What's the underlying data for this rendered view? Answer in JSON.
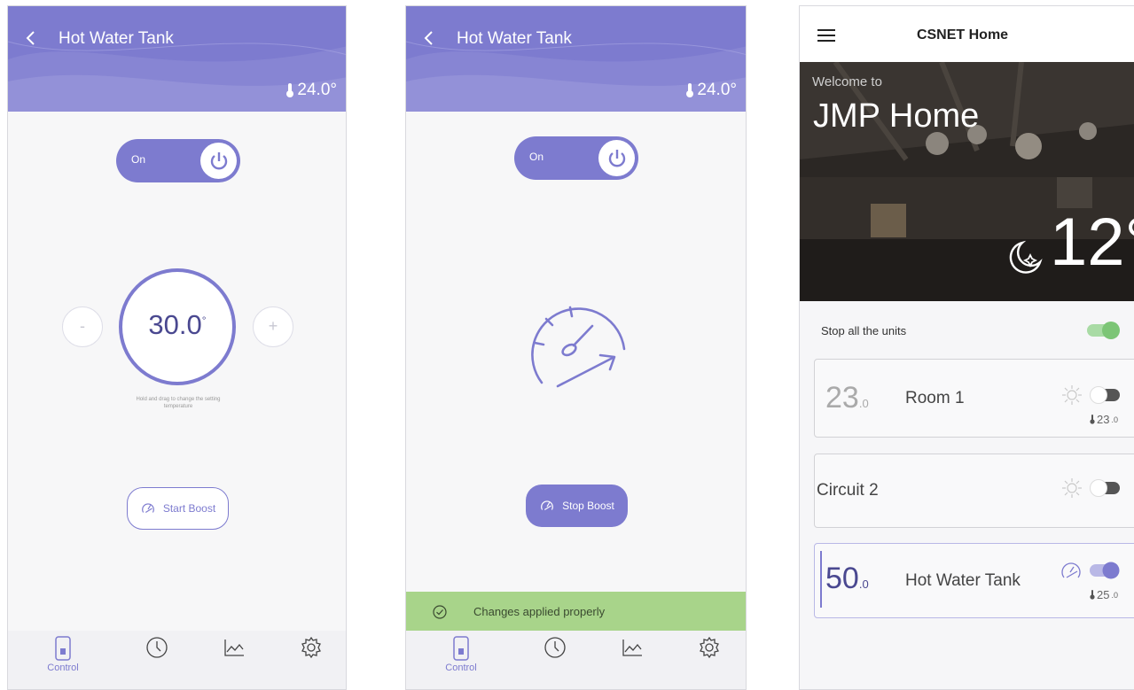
{
  "colors": {
    "accent": "#7d7bcf",
    "success": "#a8d48a",
    "toggle_on_green": "#7cc576"
  },
  "screen1": {
    "title": "Hot Water Tank",
    "current_temp": "24.0°",
    "power_label": "On",
    "setpoint": "30.0",
    "setpoint_unit": "°",
    "minus": "-",
    "plus": "+",
    "hint": "Hold and drag to change the setting temperature",
    "boost_label": "Start Boost",
    "nav": {
      "control": "Control"
    }
  },
  "screen2": {
    "title": "Hot Water Tank",
    "current_temp": "24.0°",
    "power_label": "On",
    "boost_label": "Stop Boost",
    "banner": "Changes applied properly",
    "nav": {
      "control": "Control"
    }
  },
  "screen3": {
    "app_title": "CSNET Home",
    "welcome": "Welcome to",
    "home_name": "JMP Home",
    "outdoor_temp": "12°",
    "stop_all_label": "Stop all the units",
    "units": [
      {
        "setpoint_int": "23",
        "setpoint_dec": ".0",
        "name": "Room 1",
        "room_temp": "23",
        "room_temp_dec": ".0",
        "mode_icon": "sun-icon",
        "on": false
      },
      {
        "name": "Circuit 2",
        "mode_icon": "sun-icon",
        "on": false
      },
      {
        "setpoint_int": "50",
        "setpoint_dec": ".0",
        "name": "Hot Water Tank",
        "room_temp": "25",
        "room_temp_dec": ".0",
        "mode_icon": "boost-gauge-icon",
        "on": true
      }
    ]
  }
}
